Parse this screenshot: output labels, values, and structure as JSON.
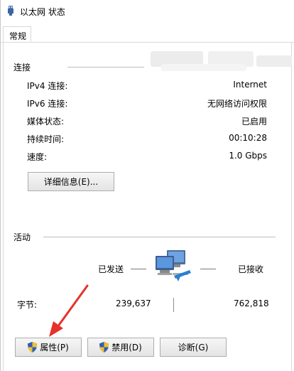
{
  "window": {
    "title": "以太网 状态"
  },
  "tabs": [
    {
      "label": "常规"
    }
  ],
  "connection": {
    "group_title": "连接",
    "rows": [
      {
        "label": "IPv4 连接:",
        "value": "Internet"
      },
      {
        "label": "IPv6 连接:",
        "value": "无网络访问权限"
      },
      {
        "label": "媒体状态:",
        "value": "已启用"
      },
      {
        "label": "持续时间:",
        "value": "00:10:28"
      },
      {
        "label": "速度:",
        "value": "1.0 Gbps"
      }
    ],
    "details_button": "详细信息(E)..."
  },
  "activity": {
    "group_title": "活动",
    "sent_label": "已发送",
    "received_label": "已接收",
    "bytes_label": "字节:",
    "bytes_sent": "239,637",
    "bytes_received": "762,818"
  },
  "buttons": {
    "properties": "属性(P)",
    "disable": "禁用(D)",
    "diagnose": "诊断(G)"
  },
  "colors": {
    "annotation_arrow": "#e8312a",
    "shield_blue": "#2f5fb3",
    "shield_yellow": "#f2c02e"
  },
  "icons": {
    "title": "ethernet-icon",
    "activity": "network-computers-icon",
    "shield": "uac-shield-icon"
  }
}
